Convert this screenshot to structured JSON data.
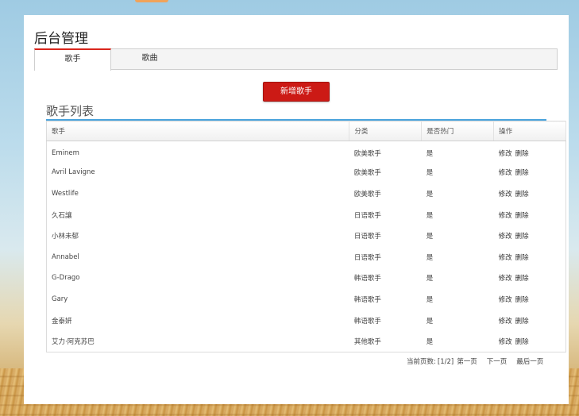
{
  "page_title": "后台管理",
  "tabs": [
    {
      "label": "歌手",
      "active": true
    },
    {
      "label": "歌曲",
      "active": false
    }
  ],
  "add_button": "新增歌手",
  "section_title": "歌手列表",
  "table": {
    "headers": [
      "歌手",
      "分类",
      "是否热门",
      "操作"
    ],
    "rows": [
      {
        "singer": "Eminem",
        "category": "欧美歌手",
        "hot": "是"
      },
      {
        "singer": "Avril Lavigne",
        "category": "欧美歌手",
        "hot": "是"
      },
      {
        "singer": "Westlife",
        "category": "欧美歌手",
        "hot": "是"
      },
      {
        "singer": "久石讓",
        "category": "日语歌手",
        "hot": "是"
      },
      {
        "singer": "小林未郁",
        "category": "日语歌手",
        "hot": "是"
      },
      {
        "singer": "Annabel",
        "category": "日语歌手",
        "hot": "是"
      },
      {
        "singer": "G-Drago",
        "category": "韩语歌手",
        "hot": "是"
      },
      {
        "singer": "Gary",
        "category": "韩语歌手",
        "hot": "是"
      },
      {
        "singer": "金泰妍",
        "category": "韩语歌手",
        "hot": "是"
      },
      {
        "singer": "艾力·阿克苏巴",
        "category": "其他歌手",
        "hot": "是"
      }
    ],
    "action_edit": "修改",
    "action_delete": "删除"
  },
  "pager": {
    "current_label": "当前页数:",
    "current_value": "[1/2]",
    "first": "第一页",
    "next": "下一页",
    "last": "最后一页"
  },
  "colors": {
    "accent_red": "#cc1a15",
    "section_line_blue": "#4aa3dc"
  }
}
